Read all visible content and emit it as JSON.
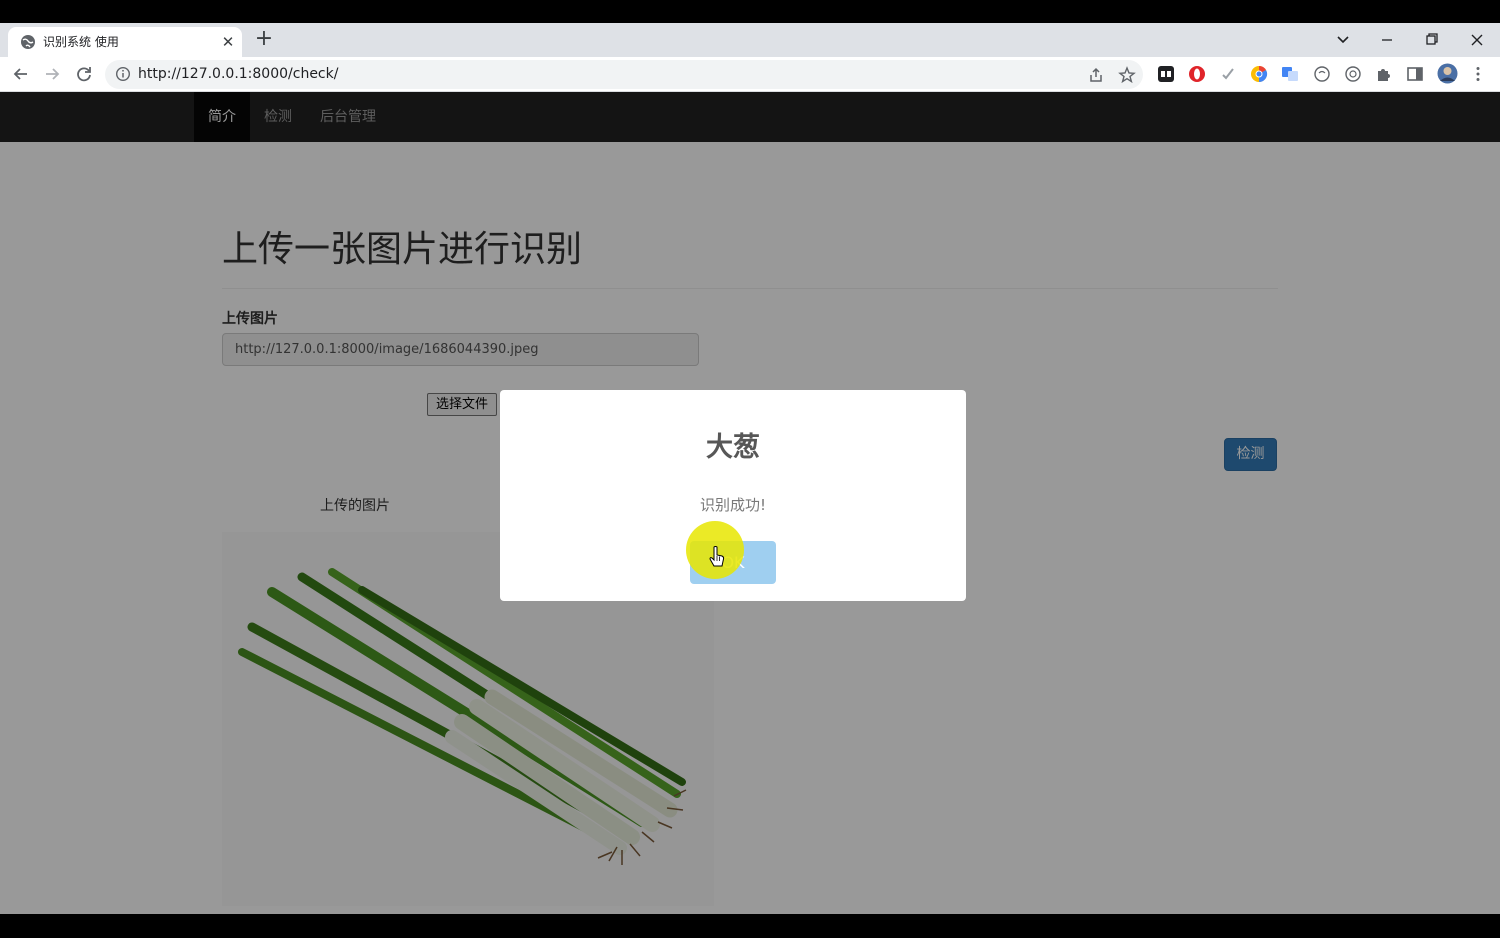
{
  "browser": {
    "tab_title": "识别系统 使用",
    "tab_close": "✕",
    "new_tab": "+",
    "url": "http://127.0.0.1:8000/check/",
    "icons": [
      "globe-icon",
      "back-arrow-icon",
      "forward-arrow-icon",
      "reload-icon",
      "site-info-icon",
      "share-icon",
      "star-icon",
      "puzzle-icon",
      "sidebar-icon",
      "menu-icon"
    ]
  },
  "nav": {
    "items": [
      {
        "label": "简介",
        "active": true
      },
      {
        "label": "检测",
        "active": false
      },
      {
        "label": "后台管理",
        "active": false
      }
    ]
  },
  "main": {
    "heading": "上传一张图片进行识别",
    "upload_label": "上传图片",
    "image_url_value": "http://127.0.0.1:8000/image/1686044390.jpeg",
    "file_button": "选择文件",
    "detect_button": "检测",
    "uploaded_caption": "上传的图片"
  },
  "modal": {
    "title": "大葱",
    "text": "识别成功!",
    "ok_button": "OK"
  },
  "colors": {
    "navbar": "#222222",
    "primary": "#337ab7",
    "ok_button": "#9fcff0",
    "cursor_highlight": "#e8e600"
  }
}
